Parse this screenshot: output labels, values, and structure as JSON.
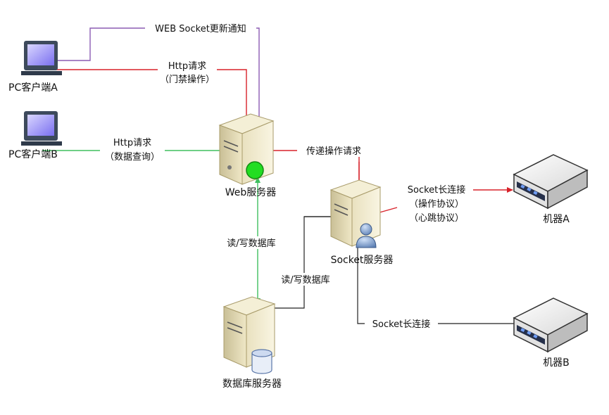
{
  "nodes": {
    "pc_a": "PC客户端A",
    "pc_b": "PC客户端B",
    "web_server": "Web服务器",
    "socket_server": "Socket服务器",
    "db_server": "数据库服务器",
    "machine_a": "机器A",
    "machine_b": "机器B"
  },
  "edges": {
    "websocket_notify": "WEB Socket更新通知",
    "http_a_line1": "Http请求",
    "http_a_line2": "（门禁操作）",
    "http_b_line1": "Http请求",
    "http_b_line2": "（数据查询）",
    "forward_request": "传递操作请求",
    "rw_db_web": "读/写数据库",
    "rw_db_socket": "读/写数据库",
    "socket_a_line1": "Socket长连接",
    "socket_a_line2": "（操作协议）",
    "socket_a_line3": "（心跳协议）",
    "socket_b": "Socket长连接"
  },
  "colors": {
    "websocket": "#8c5bb3",
    "http_red": "#d8222a",
    "http_green": "#3fbf5f",
    "black": "#222222",
    "web_status": "#22dd22"
  }
}
